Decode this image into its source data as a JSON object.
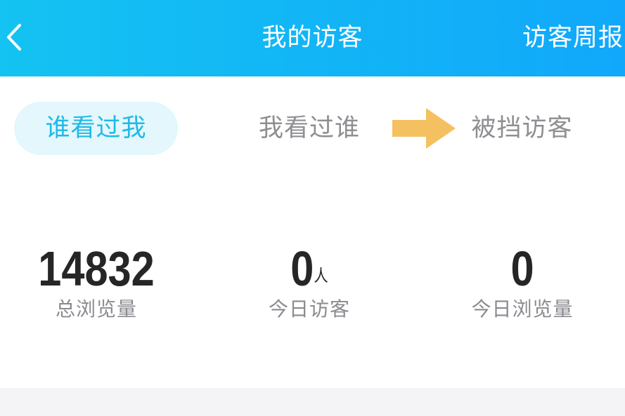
{
  "header": {
    "title": "我的访客",
    "weekly_report": "访客周报",
    "back_icon": "chevron-left-icon"
  },
  "tabs": [
    {
      "label": "谁看过我",
      "active": true
    },
    {
      "label": "我看过谁",
      "active": false
    },
    {
      "label": "被挡访客",
      "active": false
    }
  ],
  "annotation": {
    "icon": "right-arrow-icon",
    "color": "#f5c060"
  },
  "stats": [
    {
      "value": "14832",
      "unit": "",
      "label": "总浏览量"
    },
    {
      "value": "0",
      "unit": "人",
      "label": "今日访客"
    },
    {
      "value": "0",
      "unit": "",
      "label": "今日浏览量"
    }
  ],
  "colors": {
    "header_start": "#14c3f2",
    "header_end": "#11a8fb",
    "active_tab_bg": "#e3f7fc",
    "active_tab_text": "#20b9e8",
    "inactive_tab_text": "#8e8e93"
  }
}
